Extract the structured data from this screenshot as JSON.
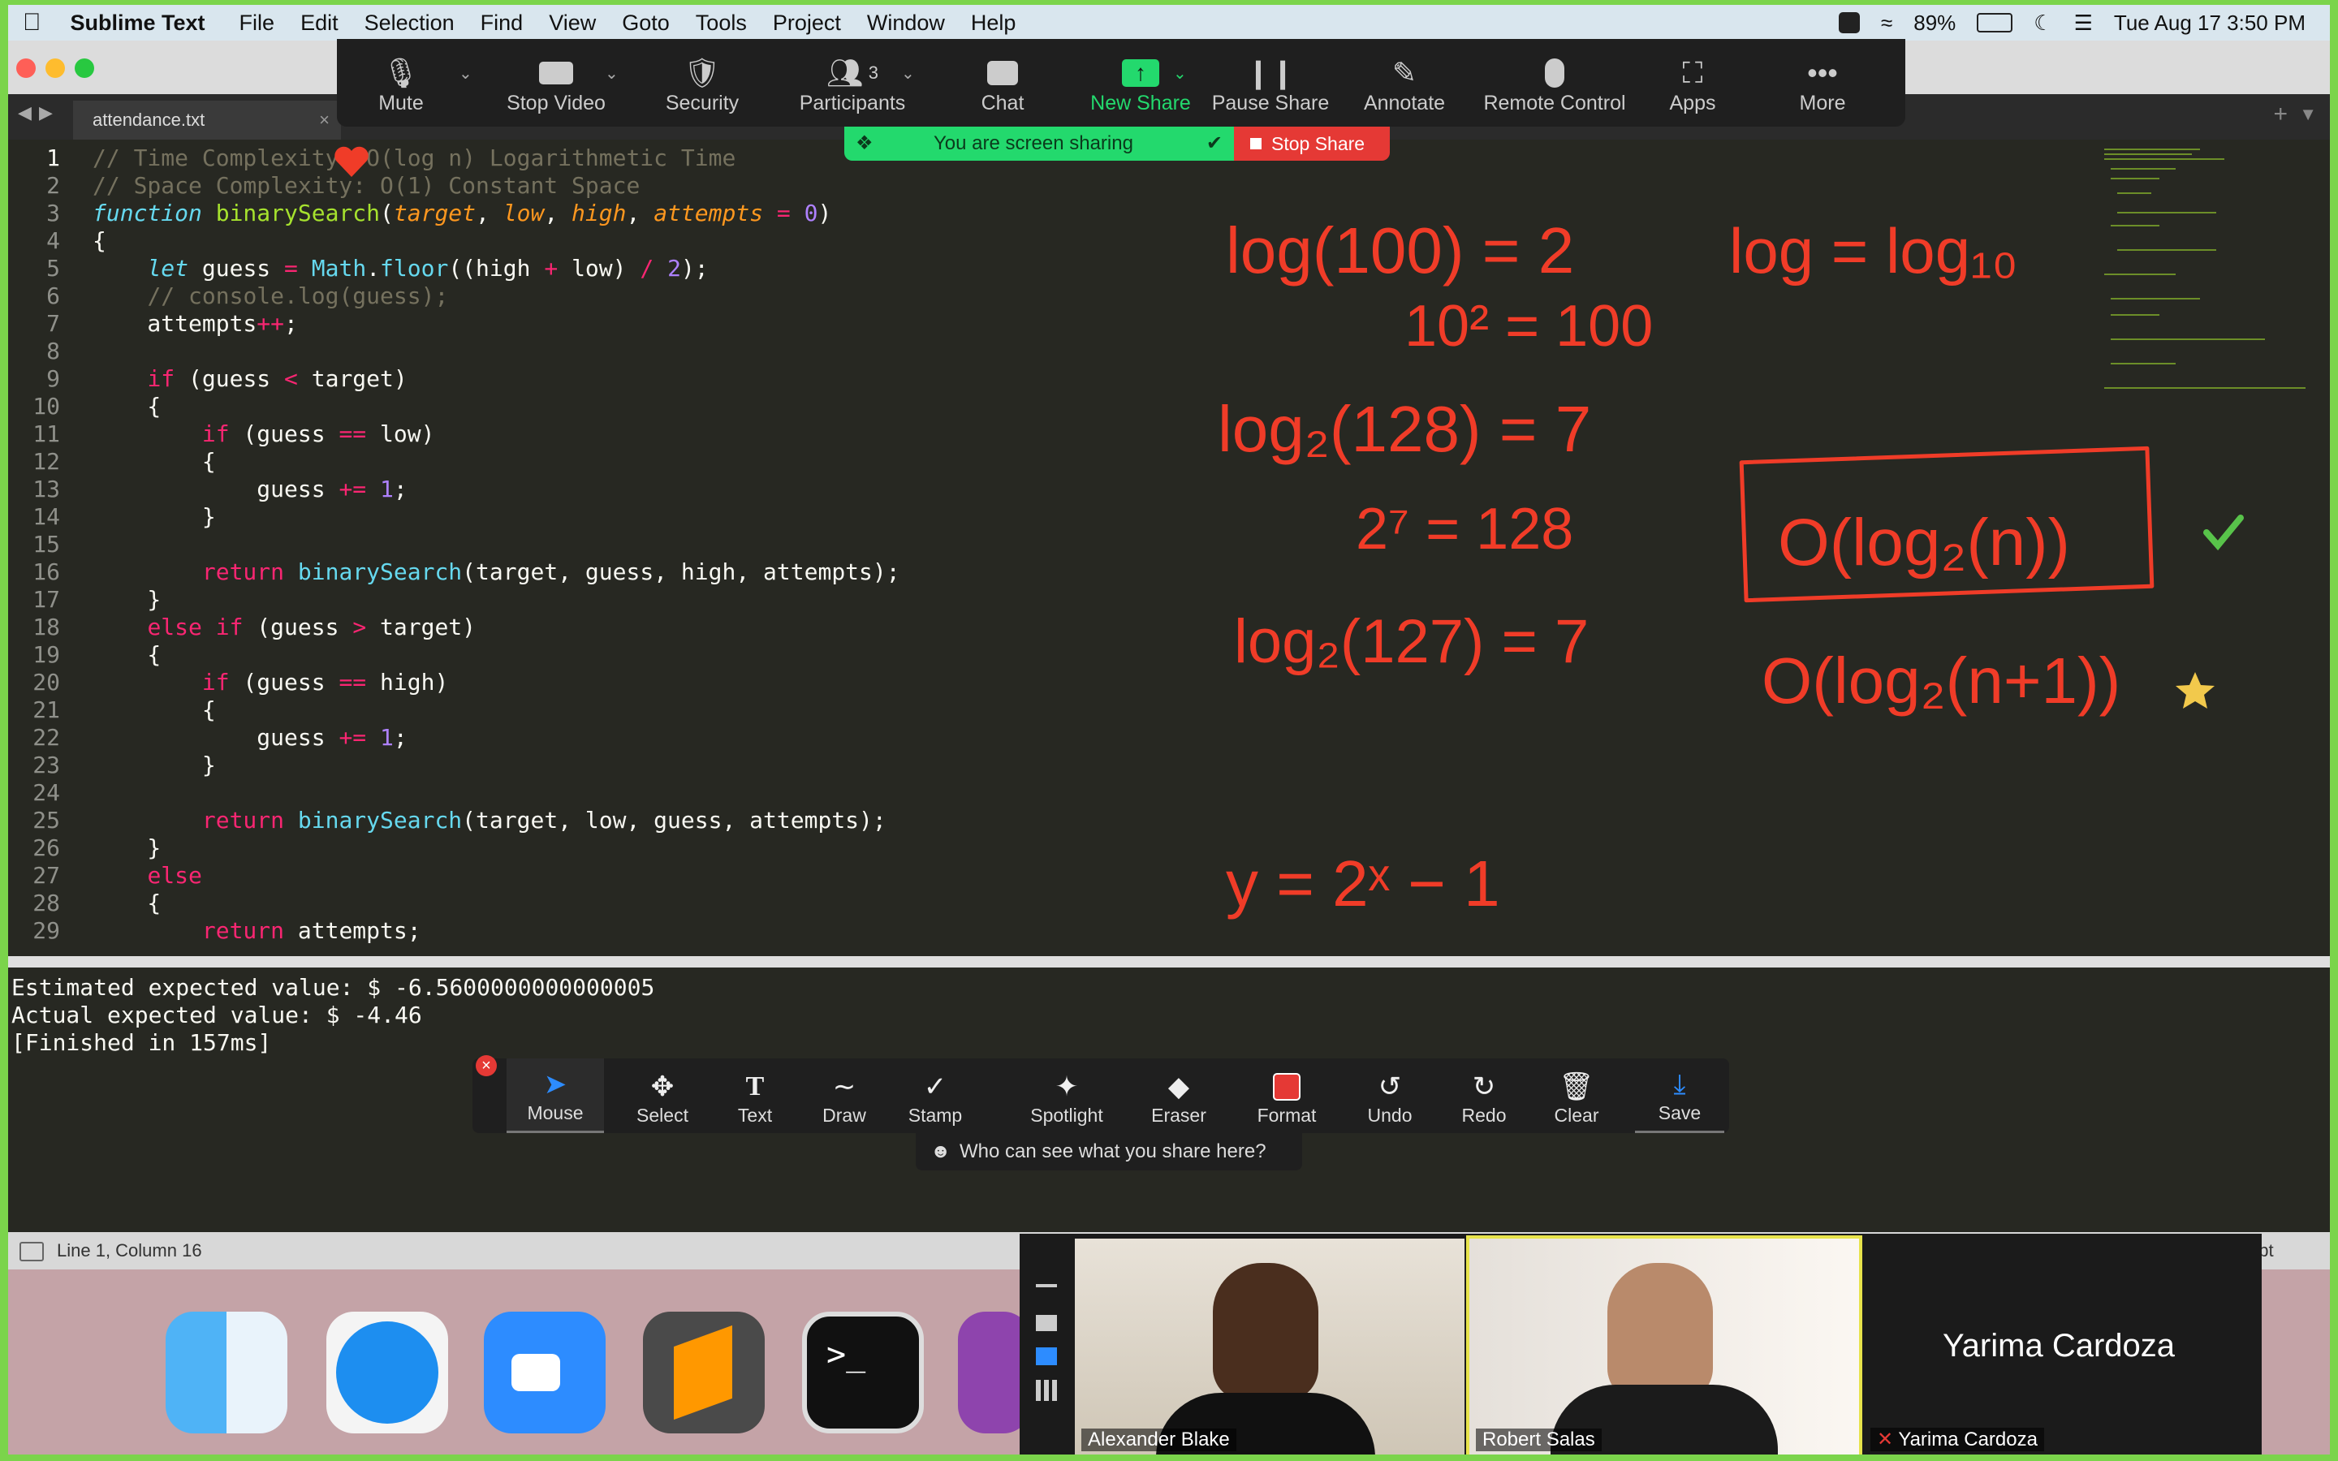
{
  "menubar": {
    "app": "Sublime Text",
    "items": [
      "File",
      "Edit",
      "Selection",
      "Find",
      "View",
      "Goto",
      "Tools",
      "Project",
      "Window",
      "Help"
    ],
    "battery": "89%",
    "datetime": "Tue Aug 17  3:50 PM"
  },
  "tab": {
    "title": "attendance.txt"
  },
  "zoom_toolbar": {
    "mute": "Mute",
    "stop_video": "Stop Video",
    "security": "Security",
    "participants": "Participants",
    "participants_count": "3",
    "chat": "Chat",
    "new_share": "New Share",
    "pause_share": "Pause Share",
    "annotate": "Annotate",
    "remote_control": "Remote Control",
    "apps": "Apps",
    "more": "More"
  },
  "share_status": {
    "text": "You are screen sharing",
    "stop": "Stop Share"
  },
  "code": {
    "line_numbers": [
      "1",
      "2",
      "3",
      "4",
      "5",
      "6",
      "7",
      "8",
      "9",
      "10",
      "11",
      "12",
      "13",
      "14",
      "15",
      "16",
      "17",
      "18",
      "19",
      "20",
      "21",
      "22",
      "23",
      "24",
      "25",
      "26",
      "27",
      "28",
      "29"
    ]
  },
  "console": {
    "line1": "Estimated expected value: $ -6.5600000000000005",
    "line2": "Actual expected value: $ -4.46",
    "line3": "[Finished in 157ms]"
  },
  "statusbar": {
    "position": "Line 1, Column 16",
    "syntax": "ript"
  },
  "annotate_toolbar": {
    "mouse": "Mouse",
    "select": "Select",
    "text": "Text",
    "draw": "Draw",
    "stamp": "Stamp",
    "spotlight": "Spotlight",
    "eraser": "Eraser",
    "format": "Format",
    "undo": "Undo",
    "redo": "Redo",
    "clear": "Clear",
    "save": "Save",
    "who_can_see": "Who can see what you share here?"
  },
  "participants": [
    {
      "name": "Alexander Blake"
    },
    {
      "name": "Robert Salas"
    },
    {
      "name": "Yarima Cardoza"
    }
  ],
  "colors": {
    "share_green": "#7bd44b",
    "annotation_red": "#f03c28",
    "zoom_green": "#23d96d",
    "stop_red": "#e53935"
  }
}
